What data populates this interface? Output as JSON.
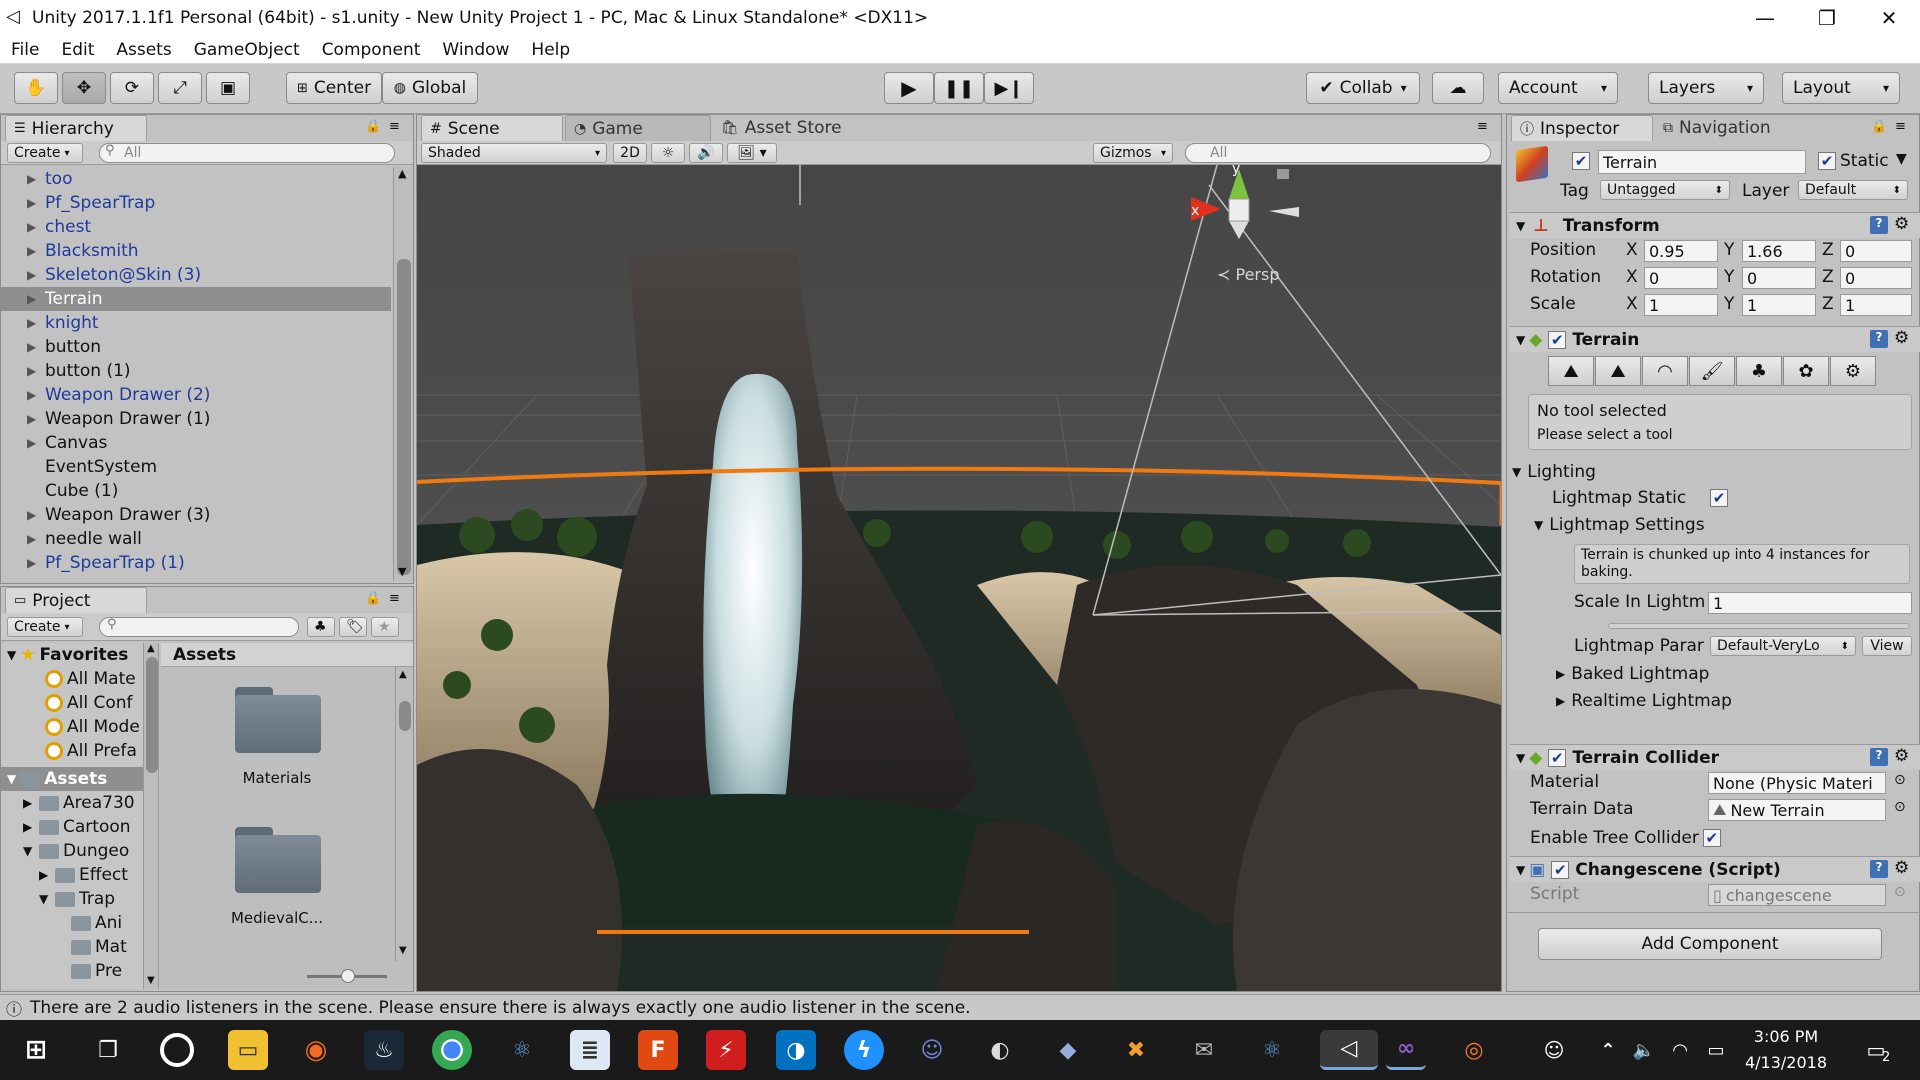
{
  "window": {
    "title": "Unity 2017.1.1f1 Personal (64bit) - s1.unity - New Unity Project 1 - PC, Mac & Linux Standalone* <DX11>",
    "controls": [
      "—",
      "❐",
      "✕"
    ]
  },
  "menu": [
    "File",
    "Edit",
    "Assets",
    "GameObject",
    "Component",
    "Window",
    "Help"
  ],
  "toolbar": {
    "pivot": "Center",
    "space": "Global",
    "collab": "Collab",
    "account": "Account",
    "layers": "Layers",
    "layout": "Layout"
  },
  "hierarchy": {
    "tab": "Hierarchy",
    "create": "Create",
    "search_placeholder": "All",
    "items": [
      {
        "label": "too",
        "prefab": true,
        "arrow": true
      },
      {
        "label": "Pf_SpearTrap",
        "prefab": true,
        "arrow": true
      },
      {
        "label": "chest",
        "prefab": true,
        "arrow": true
      },
      {
        "label": "Blacksmith",
        "prefab": true,
        "arrow": true
      },
      {
        "label": "Skeleton@Skin (3)",
        "prefab": true,
        "arrow": true
      },
      {
        "label": "Terrain",
        "prefab": false,
        "arrow": true,
        "selected": true
      },
      {
        "label": "knight",
        "prefab": true,
        "arrow": true
      },
      {
        "label": "button",
        "prefab": false,
        "arrow": true
      },
      {
        "label": "button (1)",
        "prefab": false,
        "arrow": true
      },
      {
        "label": "Weapon Drawer (2)",
        "prefab": true,
        "arrow": true
      },
      {
        "label": "Weapon Drawer (1)",
        "prefab": false,
        "arrow": true
      },
      {
        "label": "Canvas",
        "prefab": false,
        "arrow": true
      },
      {
        "label": "EventSystem",
        "prefab": false,
        "arrow": false
      },
      {
        "label": "Cube (1)",
        "prefab": false,
        "arrow": false
      },
      {
        "label": "Weapon Drawer (3)",
        "prefab": false,
        "arrow": true
      },
      {
        "label": "needle wall",
        "prefab": false,
        "arrow": true
      },
      {
        "label": "Pf_SpearTrap (1)",
        "prefab": true,
        "arrow": true
      }
    ]
  },
  "scene": {
    "tabs": [
      "Scene",
      "Game",
      "Asset Store"
    ],
    "shading": "Shaded",
    "mode2d": "2D",
    "gizmos": "Gizmos",
    "search_placeholder": "All",
    "persp": "Persp",
    "axis_y": "y",
    "axis_x": "x"
  },
  "project": {
    "tab": "Project",
    "create": "Create",
    "favorites_title": "Favorites",
    "favorites": [
      "All Mate",
      "All Conf",
      "All Mode",
      "All Prefa"
    ],
    "assets_title": "Assets",
    "tree": [
      {
        "label": "Area730",
        "depth": 1,
        "arrow": "▶"
      },
      {
        "label": "Cartoon",
        "depth": 1,
        "arrow": "▶"
      },
      {
        "label": "Dungeo",
        "depth": 1,
        "arrow": "▼"
      },
      {
        "label": "Effect",
        "depth": 2,
        "arrow": "▶"
      },
      {
        "label": "Trap",
        "depth": 2,
        "arrow": "▼"
      },
      {
        "label": "Ani",
        "depth": 3,
        "arrow": ""
      },
      {
        "label": "Mat",
        "depth": 3,
        "arrow": ""
      },
      {
        "label": "Pre",
        "depth": 3,
        "arrow": ""
      }
    ],
    "breadcrumb": "Assets",
    "folders": [
      "Materials",
      "MedievalC..."
    ]
  },
  "inspector": {
    "tabs": [
      "Inspector",
      "Navigation"
    ],
    "object_name": "Terrain",
    "static_label": "Static",
    "tag_label": "Tag",
    "tag_value": "Untagged",
    "layer_label": "Layer",
    "layer_value": "Default",
    "transform": {
      "title": "Transform",
      "position_label": "Position",
      "rotation_label": "Rotation",
      "scale_label": "Scale",
      "position": {
        "x": "0.95",
        "y": "1.66",
        "z": "0"
      },
      "rotation": {
        "x": "0",
        "y": "0",
        "z": "0"
      },
      "scale": {
        "x": "1",
        "y": "1",
        "z": "1"
      }
    },
    "terrain": {
      "title": "Terrain",
      "no_tool": "No tool selected",
      "please_select": "Please select a tool",
      "lighting": "Lighting",
      "lightmap_static": "Lightmap Static",
      "lightmap_settings": "Lightmap Settings",
      "chunk_note": "Terrain is chunked up into 4 instances for baking.",
      "scale_label": "Scale In Lightm",
      "scale_value": "1",
      "param_label": "Lightmap Parar",
      "param_value": "Default-VeryLo",
      "view_button": "View",
      "baked": "Baked Lightmap",
      "realtime": "Realtime Lightmap"
    },
    "collider": {
      "title": "Terrain Collider",
      "material_label": "Material",
      "material_value": "None (Physic Materi",
      "data_label": "Terrain Data",
      "data_value": "New Terrain",
      "tree_label": "Enable Tree Collider"
    },
    "script": {
      "title": "Changescene (Script)",
      "label": "Script",
      "value": "changescene"
    },
    "add_component": "Add Component"
  },
  "status": {
    "message": "There are 2 audio listeners in the scene. Please ensure there is always exactly one audio listener in the scene."
  },
  "taskbar": {
    "time": "3:06 PM",
    "date": "4/13/2018",
    "notifications": "2"
  },
  "colors": {
    "selection": "#8f8f8f",
    "prefab_text": "#1e3a9e",
    "scene_orange": "#f07a10",
    "scene_sky": "#4a4a4a"
  }
}
